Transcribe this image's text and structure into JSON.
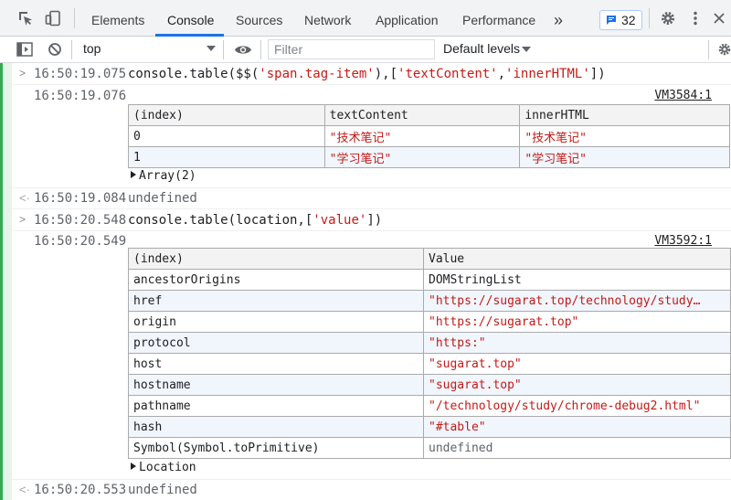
{
  "tabs": [
    {
      "label": "Elements"
    },
    {
      "label": "Console"
    },
    {
      "label": "Sources"
    },
    {
      "label": "Network"
    },
    {
      "label": "Application"
    },
    {
      "label": "Performance"
    }
  ],
  "more_tabs": "»",
  "issues_count": "32",
  "toolbar": {
    "context": "top",
    "filter_placeholder": "Filter",
    "levels": "Default levels"
  },
  "colors": {
    "accent": "#1a73e8",
    "string": "#c41a16",
    "gutter": "#34a853"
  },
  "entries": {
    "cmd1": {
      "time": "16:50:19.075",
      "pre": "console.table($$(",
      "s1": "'span.tag-item'",
      "mid": "),[",
      "s2": "'textContent'",
      "comma": ",",
      "s3": "'innerHTML'",
      "post": "])"
    },
    "out1": {
      "time": "16:50:19.076",
      "source": "VM3584:1",
      "headers": [
        "(index)",
        "textContent",
        "innerHTML"
      ],
      "rows": [
        [
          "0",
          "\"技术笔记\"",
          "\"技术笔记\""
        ],
        [
          "1",
          "\"学习笔记\"",
          "\"学习笔记\""
        ]
      ],
      "expander": "Array(2)"
    },
    "ret1": {
      "time": "16:50:19.084",
      "value": "undefined"
    },
    "cmd2": {
      "time": "16:50:20.548",
      "pre": "console.table(location,[",
      "s1": "'value'",
      "post": "])"
    },
    "out2": {
      "time": "16:50:20.549",
      "source": "VM3592:1",
      "headers": [
        "(index)",
        "Value"
      ],
      "rows": [
        [
          "ancestorOrigins",
          "DOMStringList"
        ],
        [
          "href",
          "\"https://sugarat.top/technology/study…"
        ],
        [
          "origin",
          "\"https://sugarat.top\""
        ],
        [
          "protocol",
          "\"https:\""
        ],
        [
          "host",
          "\"sugarat.top\""
        ],
        [
          "hostname",
          "\"sugarat.top\""
        ],
        [
          "pathname",
          "\"/technology/study/chrome-debug2.html\""
        ],
        [
          "hash",
          "\"#table\""
        ],
        [
          "Symbol(Symbol.toPrimitive)",
          "undefined"
        ]
      ],
      "expander": "Location"
    },
    "ret2": {
      "time": "16:50:20.553",
      "value": "undefined"
    }
  }
}
